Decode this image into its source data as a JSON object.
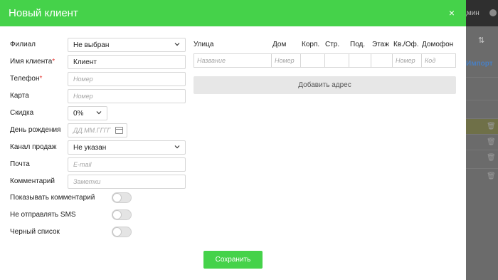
{
  "modal": {
    "title": "Новый клиент",
    "close_icon": "×",
    "accent_color": "#45d24a"
  },
  "background": {
    "user_label": "дмин",
    "filter_icon": "⇅",
    "import_label": "Импорт",
    "trash_icon": "🗑"
  },
  "form": {
    "branch": {
      "label": "Филиал",
      "value": "Не выбран"
    },
    "client_name": {
      "label": "Имя клиента",
      "required_mark": "*",
      "value": "Клиент"
    },
    "phone": {
      "label": "Телефон",
      "required_mark": "*",
      "placeholder": "Номер"
    },
    "card": {
      "label": "Карта",
      "placeholder": "Номер"
    },
    "discount": {
      "label": "Скидка",
      "value": "0%"
    },
    "birthday": {
      "label": "День рождения",
      "placeholder": "ДД.ММ.ГГГГ"
    },
    "sales_channel": {
      "label": "Канал продаж",
      "value": "Не указан"
    },
    "email": {
      "label": "Почта",
      "placeholder": "E-mail"
    },
    "comment": {
      "label": "Комментарий",
      "placeholder": "Заметки"
    },
    "show_comment": {
      "label": "Показывать комментарий",
      "enabled": false
    },
    "no_sms": {
      "label": "Не отправлять SMS",
      "enabled": false
    },
    "blacklist": {
      "label": "Черный список",
      "enabled": false
    }
  },
  "address": {
    "headers": [
      "Улица",
      "Дом",
      "Корп.",
      "Стр.",
      "Под.",
      "Этаж",
      "Кв./Оф.",
      "Домофон"
    ],
    "placeholders": [
      "Название",
      "Номер",
      "",
      "",
      "",
      "",
      "Номер",
      "Код"
    ],
    "add_button": "Добавить адрес"
  },
  "actions": {
    "save": "Сохранить"
  }
}
